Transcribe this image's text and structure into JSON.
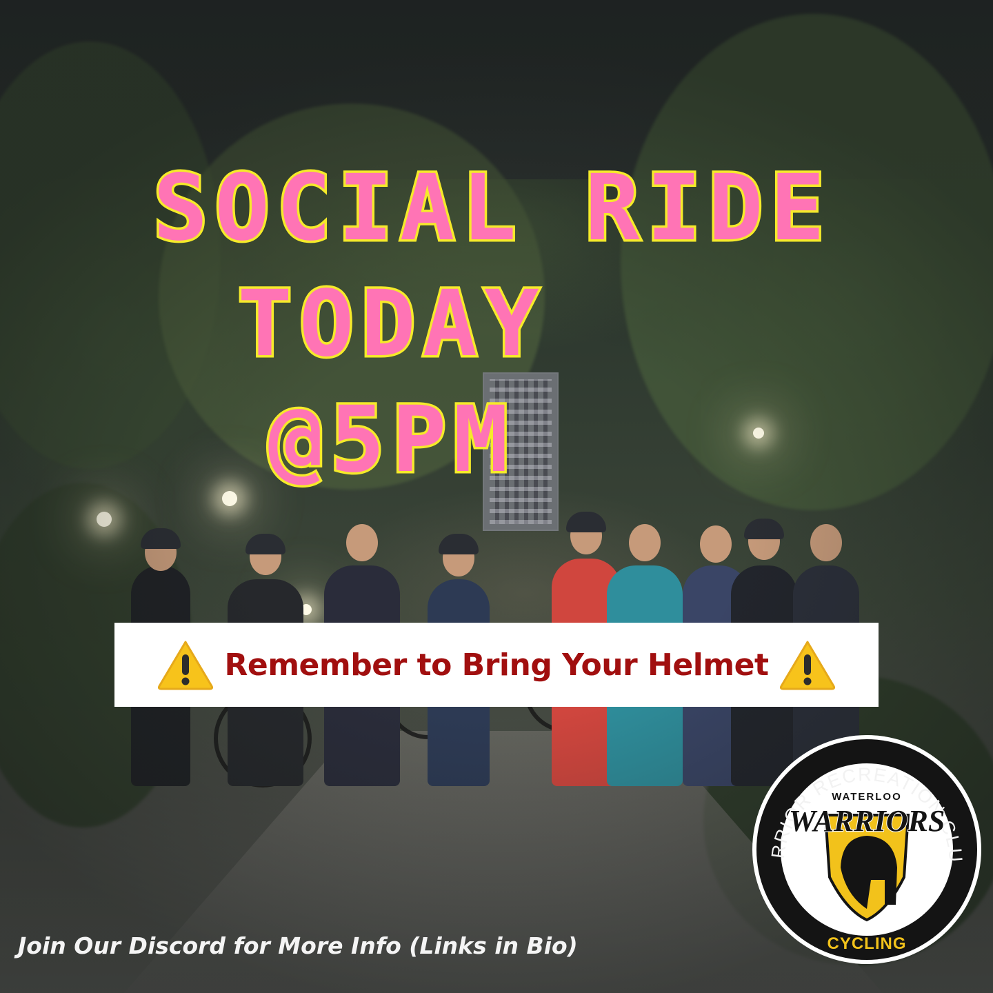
{
  "headline": {
    "line1": "SOCIAL RIDE",
    "line2": "TODAY",
    "line3": "@5PM"
  },
  "banner": {
    "text": "Remember to Bring Your Helmet",
    "icon_left": "warning-icon",
    "icon_right": "warning-icon"
  },
  "logo": {
    "ring_text": "WARRIOR RECREATION CLUBS",
    "top_text": "WATERLOO",
    "wordmark": "WARRIORS",
    "bottom_text": "CYCLING"
  },
  "footer": {
    "text": "Join Our Discord for More Info (Links in Bio)"
  },
  "colors": {
    "headline_fill": "#ff74b5",
    "headline_outline": "#f5ea2a",
    "banner_text": "#a10f0f",
    "logo_gold": "#f2c21b"
  }
}
